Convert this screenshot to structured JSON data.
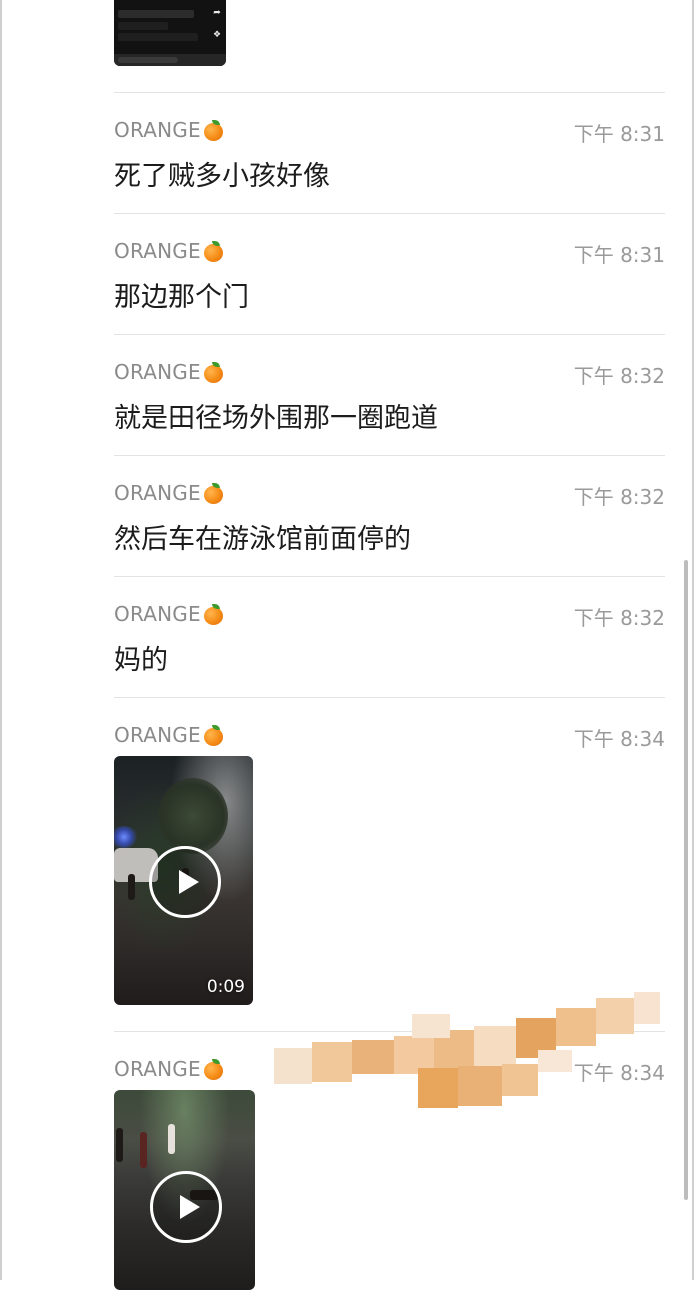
{
  "chat": {
    "messages": [
      {
        "sender": "ORANGE",
        "time": "下午 8:31",
        "text": "死了贼多小孩好像"
      },
      {
        "sender": "ORANGE",
        "time": "下午 8:31",
        "text": "那边那个门"
      },
      {
        "sender": "ORANGE",
        "time": "下午 8:32",
        "text": "就是田径场外围那一圈跑道"
      },
      {
        "sender": "ORANGE",
        "time": "下午 8:32",
        "text": "然后车在游泳馆前面停的"
      },
      {
        "sender": "ORANGE",
        "time": "下午 8:32",
        "text": "妈的"
      },
      {
        "sender": "ORANGE",
        "time": "下午 8:34",
        "video_duration": "0:09"
      },
      {
        "sender": "ORANGE",
        "time": "下午 8:34"
      }
    ]
  },
  "icons": {
    "sender_emoji": "orange-icon",
    "video_play": "play-icon"
  },
  "colors": {
    "sender": "#8a8a8a",
    "time": "#9a9a9a",
    "text": "#1c1c1c",
    "divider": "#e3e3e3",
    "orange": "#f58b16"
  }
}
